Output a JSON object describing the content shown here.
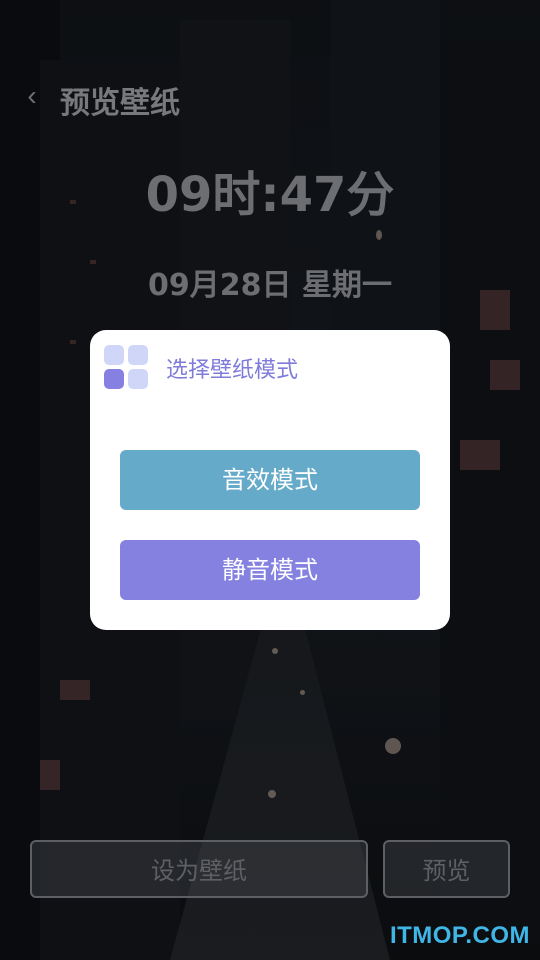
{
  "header": {
    "back_icon": "chevron-left-icon",
    "back_glyph": "‹",
    "title": "预览壁纸"
  },
  "lockscreen": {
    "time": "09时:47分",
    "date": "09月28日 星期一"
  },
  "dialog": {
    "icon": "grid-apps-icon",
    "title": "选择壁纸模式",
    "sound_mode_label": "音效模式",
    "mute_mode_label": "静音模式"
  },
  "bottom": {
    "set_wallpaper_label": "设为壁纸",
    "preview_label": "预览"
  },
  "watermark": "ITMOP.COM",
  "colors": {
    "dialog_title": "#7f7bd9",
    "sound_button": "#66aac9",
    "mute_button": "#8481e0",
    "watermark": "#3fb6e6"
  }
}
